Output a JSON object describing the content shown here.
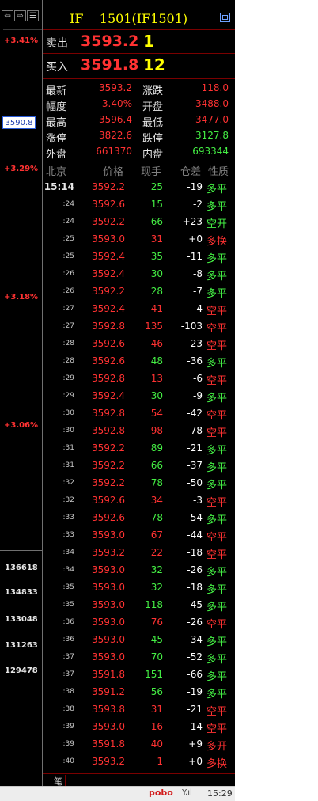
{
  "header": {
    "title": "IF    1501(IF1501)"
  },
  "axis": {
    "pct_labels": [
      "+3.41%",
      "+3.29%",
      "+3.18%",
      "+3.06%"
    ],
    "price_cursor": "3590.8",
    "volume_labels": [
      "136618",
      "134833",
      "133048",
      "131263",
      "129478"
    ]
  },
  "quote": {
    "sell_label": "卖出",
    "sell_price": "3593.2",
    "sell_vol": "1",
    "buy_label": "买入",
    "buy_price": "3591.8",
    "buy_vol": "12"
  },
  "stats": [
    {
      "l1": "最新",
      "v1": "3593.2",
      "c1": "#ff3232",
      "l2": "涨跌",
      "v2": "118.0",
      "c2": "#ff3232"
    },
    {
      "l1": "幅度",
      "v1": "3.40%",
      "c1": "#ff3232",
      "l2": "开盘",
      "v2": "3488.0",
      "c2": "#ff3232"
    },
    {
      "l1": "最高",
      "v1": "3596.4",
      "c1": "#ff3232",
      "l2": "最低",
      "v2": "3477.0",
      "c2": "#ff3232"
    },
    {
      "l1": "涨停",
      "v1": "3822.6",
      "c1": "#ff3232",
      "l2": "跌停",
      "v2": "3127.8",
      "c2": "#44ee44"
    },
    {
      "l1": "外盘",
      "v1": "661370",
      "c1": "#ff3232",
      "l2": "内盘",
      "v2": "693344",
      "c2": "#44ee44"
    }
  ],
  "table": {
    "headers": {
      "city": "北京",
      "price": "价格",
      "vol": "现手",
      "oi": "仓差",
      "nature": "性质"
    },
    "rows": [
      {
        "t": "15:14",
        "p": "3592.2",
        "v": "25",
        "vc": "#44ee44",
        "o": "-19",
        "n": "多平",
        "nc": "#44ee44"
      },
      {
        "t": ":24",
        "p": "3592.6",
        "v": "15",
        "vc": "#44ee44",
        "o": "-2",
        "n": "多平",
        "nc": "#44ee44"
      },
      {
        "t": ":24",
        "p": "3592.2",
        "v": "66",
        "vc": "#44ee44",
        "o": "+23",
        "n": "空开",
        "nc": "#44ee44"
      },
      {
        "t": ":25",
        "p": "3593.0",
        "v": "31",
        "vc": "#ff3232",
        "o": "+0",
        "n": "多换",
        "nc": "#ff3232"
      },
      {
        "t": ":25",
        "p": "3592.4",
        "v": "35",
        "vc": "#44ee44",
        "o": "-11",
        "n": "多平",
        "nc": "#44ee44"
      },
      {
        "t": ":26",
        "p": "3592.4",
        "v": "30",
        "vc": "#44ee44",
        "o": "-8",
        "n": "多平",
        "nc": "#44ee44"
      },
      {
        "t": ":26",
        "p": "3592.2",
        "v": "28",
        "vc": "#44ee44",
        "o": "-7",
        "n": "多平",
        "nc": "#44ee44"
      },
      {
        "t": ":27",
        "p": "3592.4",
        "v": "41",
        "vc": "#ff3232",
        "o": "-4",
        "n": "空平",
        "nc": "#ff3232"
      },
      {
        "t": ":27",
        "p": "3592.8",
        "v": "135",
        "vc": "#ff3232",
        "o": "-103",
        "n": "空平",
        "nc": "#ff3232"
      },
      {
        "t": ":28",
        "p": "3592.6",
        "v": "46",
        "vc": "#ff3232",
        "o": "-23",
        "n": "空平",
        "nc": "#ff3232"
      },
      {
        "t": ":28",
        "p": "3592.6",
        "v": "48",
        "vc": "#44ee44",
        "o": "-36",
        "n": "多平",
        "nc": "#44ee44"
      },
      {
        "t": ":29",
        "p": "3592.8",
        "v": "13",
        "vc": "#ff3232",
        "o": "-6",
        "n": "空平",
        "nc": "#ff3232"
      },
      {
        "t": ":29",
        "p": "3592.4",
        "v": "30",
        "vc": "#44ee44",
        "o": "-9",
        "n": "多平",
        "nc": "#44ee44"
      },
      {
        "t": ":30",
        "p": "3592.8",
        "v": "54",
        "vc": "#ff3232",
        "o": "-42",
        "n": "空平",
        "nc": "#ff3232"
      },
      {
        "t": ":30",
        "p": "3592.8",
        "v": "98",
        "vc": "#ff3232",
        "o": "-78",
        "n": "空平",
        "nc": "#ff3232"
      },
      {
        "t": ":31",
        "p": "3592.2",
        "v": "89",
        "vc": "#44ee44",
        "o": "-21",
        "n": "多平",
        "nc": "#44ee44"
      },
      {
        "t": ":31",
        "p": "3592.2",
        "v": "66",
        "vc": "#44ee44",
        "o": "-37",
        "n": "多平",
        "nc": "#44ee44"
      },
      {
        "t": ":32",
        "p": "3592.2",
        "v": "78",
        "vc": "#44ee44",
        "o": "-50",
        "n": "多平",
        "nc": "#44ee44"
      },
      {
        "t": ":32",
        "p": "3592.6",
        "v": "34",
        "vc": "#ff3232",
        "o": "-3",
        "n": "空平",
        "nc": "#ff3232"
      },
      {
        "t": ":33",
        "p": "3592.6",
        "v": "78",
        "vc": "#44ee44",
        "o": "-54",
        "n": "多平",
        "nc": "#44ee44"
      },
      {
        "t": ":33",
        "p": "3593.0",
        "v": "67",
        "vc": "#ff3232",
        "o": "-44",
        "n": "空平",
        "nc": "#ff3232"
      },
      {
        "t": ":34",
        "p": "3593.2",
        "v": "22",
        "vc": "#ff3232",
        "o": "-18",
        "n": "空平",
        "nc": "#ff3232"
      },
      {
        "t": ":34",
        "p": "3593.0",
        "v": "32",
        "vc": "#44ee44",
        "o": "-26",
        "n": "多平",
        "nc": "#44ee44"
      },
      {
        "t": ":35",
        "p": "3593.0",
        "v": "32",
        "vc": "#44ee44",
        "o": "-18",
        "n": "多平",
        "nc": "#44ee44"
      },
      {
        "t": ":35",
        "p": "3593.0",
        "v": "118",
        "vc": "#44ee44",
        "o": "-45",
        "n": "多平",
        "nc": "#44ee44"
      },
      {
        "t": ":36",
        "p": "3593.0",
        "v": "76",
        "vc": "#ff3232",
        "o": "-26",
        "n": "空平",
        "nc": "#ff3232"
      },
      {
        "t": ":36",
        "p": "3593.0",
        "v": "45",
        "vc": "#44ee44",
        "o": "-34",
        "n": "多平",
        "nc": "#44ee44"
      },
      {
        "t": ":37",
        "p": "3593.0",
        "v": "70",
        "vc": "#44ee44",
        "o": "-52",
        "n": "多平",
        "nc": "#44ee44"
      },
      {
        "t": ":37",
        "p": "3591.8",
        "v": "151",
        "vc": "#44ee44",
        "o": "-66",
        "n": "多平",
        "nc": "#44ee44"
      },
      {
        "t": ":38",
        "p": "3591.2",
        "v": "56",
        "vc": "#44ee44",
        "o": "-19",
        "n": "多平",
        "nc": "#44ee44"
      },
      {
        "t": ":38",
        "p": "3593.8",
        "v": "31",
        "vc": "#ff3232",
        "o": "-21",
        "n": "空平",
        "nc": "#ff3232"
      },
      {
        "t": ":39",
        "p": "3593.0",
        "v": "16",
        "vc": "#ff3232",
        "o": "-14",
        "n": "空平",
        "nc": "#ff3232"
      },
      {
        "t": ":39",
        "p": "3591.8",
        "v": "40",
        "vc": "#ff3232",
        "o": "+9",
        "n": "多开",
        "nc": "#ff3232"
      },
      {
        "t": ":40",
        "p": "3593.2",
        "v": "1",
        "vc": "#ff3232",
        "o": "+0",
        "n": "多换",
        "nc": "#ff3232"
      }
    ]
  },
  "footer": {
    "tab_label": "笔"
  },
  "statusbar": {
    "logo": "pobo",
    "signal": "Y.ıl",
    "time": "15:29"
  },
  "colors": {
    "up": "#ff3232",
    "down": "#44ee44",
    "title": "#ffff00",
    "background": "#000000"
  }
}
